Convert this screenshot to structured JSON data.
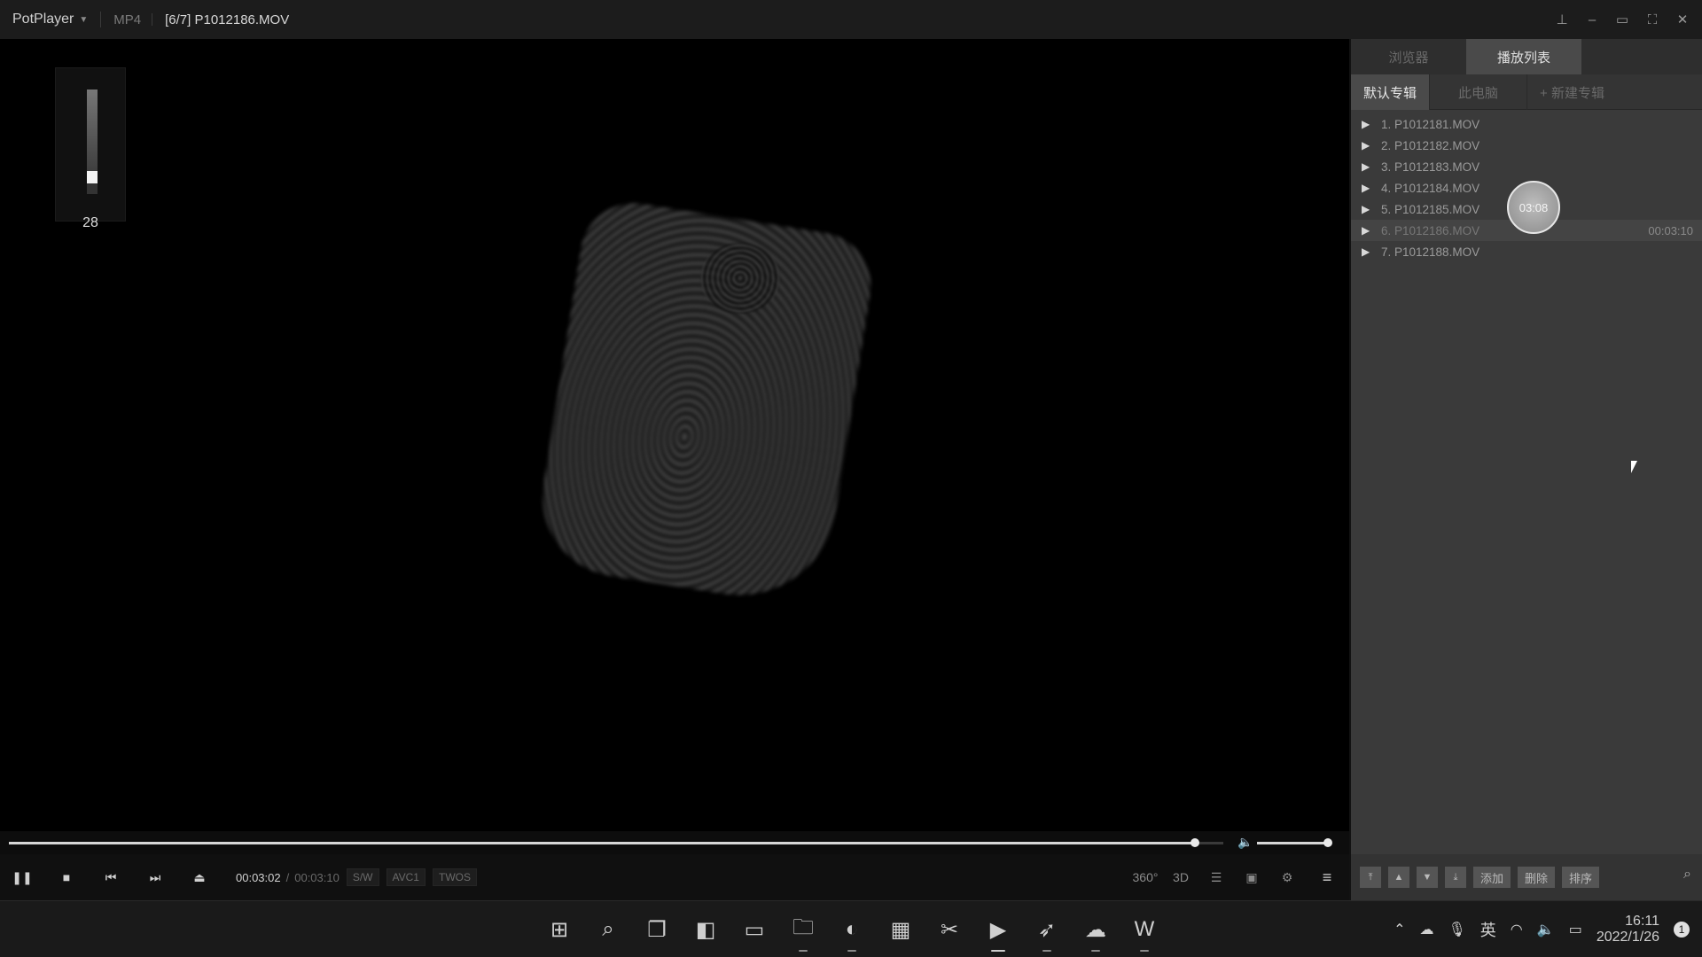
{
  "titlebar": {
    "brand": "PotPlayer",
    "format": "MP4",
    "file_title": "[6/7] P1012186.MOV",
    "controls": [
      "pin-icon",
      "minimize-icon",
      "restore-icon",
      "fullscreen-icon",
      "close-icon"
    ]
  },
  "osd": {
    "volume_value": "28",
    "volume_level": 0.28
  },
  "seek": {
    "position_fraction": 0.977,
    "volume_fraction": 0.95
  },
  "controlbar": {
    "time_current": "00:03:02",
    "time_separator": "/",
    "time_total": "00:03:10",
    "badges": [
      "S/W",
      "AVC1",
      "TWOS"
    ],
    "right_buttons": [
      "360°",
      "3D"
    ]
  },
  "panel": {
    "tabs": [
      "浏览器",
      "播放列表"
    ],
    "active_tab": 1,
    "subtabs": [
      "默认专辑",
      "此电脑",
      "+ 新建专辑"
    ],
    "items": [
      {
        "label": "1. P1012181.MOV"
      },
      {
        "label": "2. P1012182.MOV"
      },
      {
        "label": "3. P1012183.MOV"
      },
      {
        "label": "4. P1012184.MOV"
      },
      {
        "label": "5. P1012185.MOV"
      },
      {
        "label": "6. P1012186.MOV",
        "duration": "00:03:10"
      },
      {
        "label": "7. P1012188.MOV"
      }
    ],
    "hover_time": "03:08",
    "bottom_buttons": [
      "添加",
      "删除",
      "排序"
    ]
  },
  "taskbar": {
    "apps": [
      "start-icon",
      "search-icon",
      "task-view-icon",
      "widgets-icon",
      "terminal-icon",
      "file-explorer-icon",
      "edge-icon",
      "store-icon",
      "snipping-icon",
      "potplayer-icon",
      "feishu-icon",
      "wechat-icon",
      "word-icon"
    ],
    "ime": "英",
    "time": "16:11",
    "date": "2022/1/26",
    "notification_count": "1"
  },
  "colors": {
    "titlebar_bg": "#1c1c1c",
    "panel_bg": "#3a3a3a",
    "taskbar_bg": "#1a1a1a"
  }
}
